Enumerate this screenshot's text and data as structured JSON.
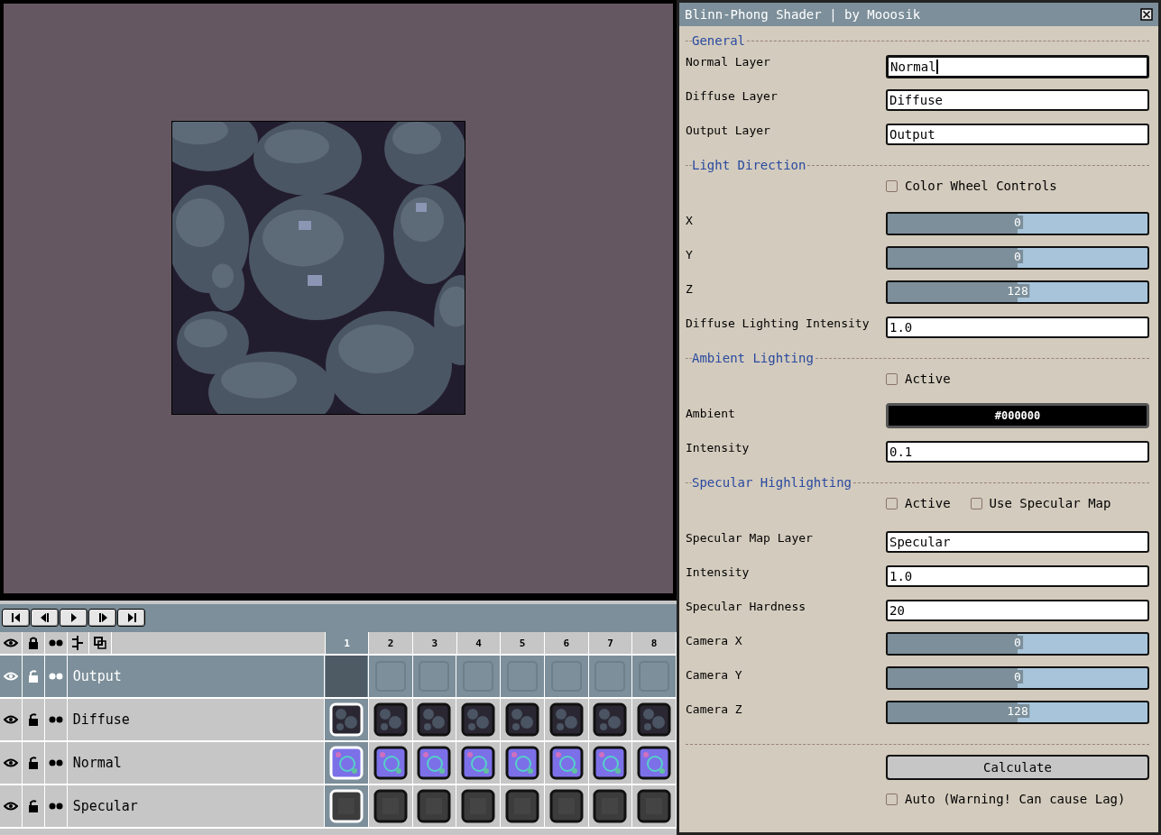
{
  "timeline": {
    "frames": [
      {
        "label": "1",
        "selected": true
      },
      {
        "label": "2",
        "selected": false
      },
      {
        "label": "3",
        "selected": false
      },
      {
        "label": "4",
        "selected": false
      },
      {
        "label": "5",
        "selected": false
      },
      {
        "label": "6",
        "selected": false
      },
      {
        "label": "7",
        "selected": false
      },
      {
        "label": "8",
        "selected": false
      }
    ],
    "layers": [
      {
        "name": "Output",
        "selected": true,
        "kind": "empty"
      },
      {
        "name": "Diffuse",
        "selected": false,
        "kind": "diffuse"
      },
      {
        "name": "Normal",
        "selected": false,
        "kind": "normal"
      },
      {
        "name": "Specular",
        "selected": false,
        "kind": "specular"
      }
    ]
  },
  "dialog": {
    "title": "Blinn-Phong Shader | by Mooosik",
    "rows": [
      {
        "kind": "section",
        "label": "General"
      },
      {
        "kind": "field",
        "label": "Normal Layer",
        "value": "Normal",
        "focused": true
      },
      {
        "kind": "field",
        "label": "Diffuse Layer",
        "value": "Diffuse",
        "focused": false
      },
      {
        "kind": "field",
        "label": "Output Layer",
        "value": "Output",
        "focused": false
      },
      {
        "kind": "section",
        "label": "Light Direction"
      },
      {
        "kind": "checks",
        "items": [
          {
            "label": "Color Wheel Controls",
            "checked": false
          }
        ]
      },
      {
        "kind": "slider",
        "label": "X",
        "value": "0",
        "level": 0.5
      },
      {
        "kind": "slider",
        "label": "Y",
        "value": "0",
        "level": 0.5
      },
      {
        "kind": "slider",
        "label": "Z",
        "value": "128",
        "level": 0.5
      },
      {
        "kind": "field",
        "label": "Diffuse Lighting Intensity",
        "value": "1.0",
        "focused": false
      },
      {
        "kind": "section",
        "label": "Ambient Lighting"
      },
      {
        "kind": "checks",
        "items": [
          {
            "label": "Active",
            "checked": false
          }
        ]
      },
      {
        "kind": "color",
        "label": "Ambient",
        "value": "#000000"
      },
      {
        "kind": "field",
        "label": "Intensity",
        "value": "0.1",
        "focused": false
      },
      {
        "kind": "section",
        "label": "Specular Highlighting"
      },
      {
        "kind": "checks",
        "items": [
          {
            "label": "Active",
            "checked": false
          },
          {
            "label": "Use Specular Map",
            "checked": false
          }
        ]
      },
      {
        "kind": "field",
        "label": "Specular Map Layer",
        "value": "Specular",
        "focused": false
      },
      {
        "kind": "field",
        "label": "Intensity",
        "value": "1.0",
        "focused": false
      },
      {
        "kind": "field",
        "label": "Specular Hardness",
        "value": "20",
        "focused": false
      },
      {
        "kind": "slider",
        "label": "Camera X",
        "value": "0",
        "level": 0.5
      },
      {
        "kind": "slider",
        "label": "Camera Y",
        "value": "0",
        "level": 0.5
      },
      {
        "kind": "slider",
        "label": "Camera Z",
        "value": "128",
        "level": 0.5
      },
      {
        "kind": "divider"
      },
      {
        "kind": "button",
        "label": "Calculate"
      },
      {
        "kind": "checks",
        "items": [
          {
            "label": "Auto (Warning! Can cause Lag)",
            "checked": false
          }
        ]
      }
    ]
  }
}
